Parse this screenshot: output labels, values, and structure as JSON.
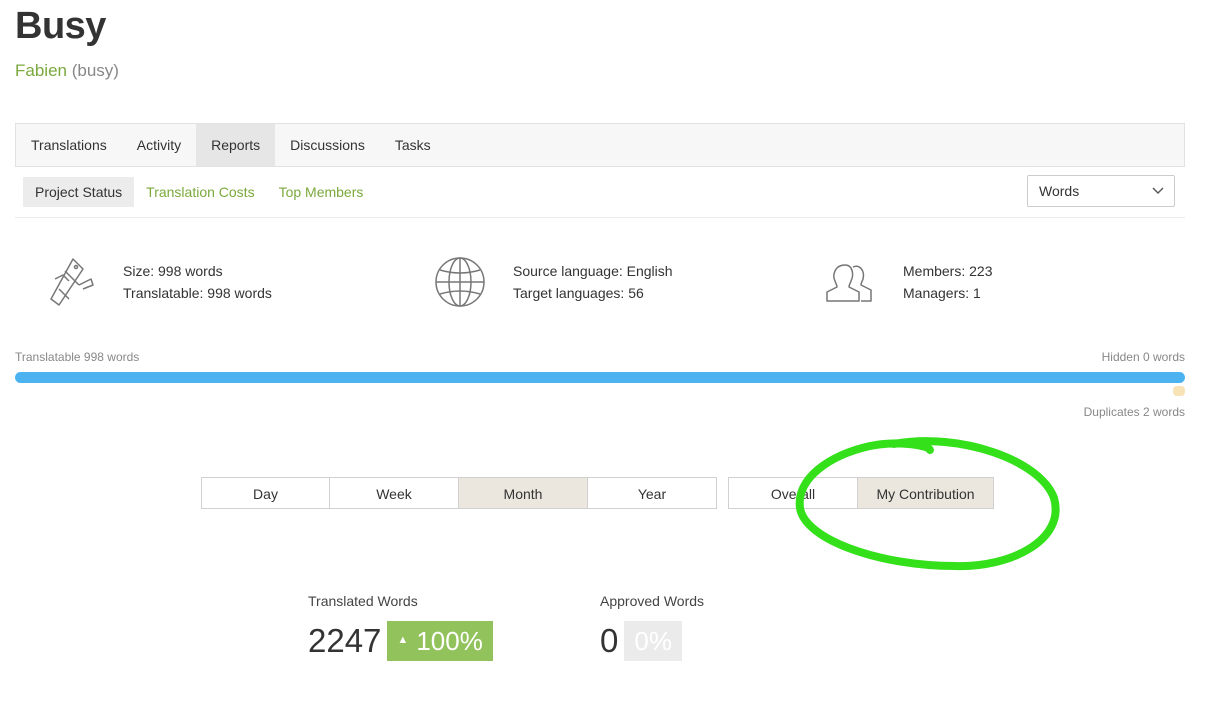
{
  "project": {
    "title": "Busy",
    "owner": "Fabien",
    "handle": "(busy)"
  },
  "tabs": [
    {
      "label": "Translations"
    },
    {
      "label": "Activity"
    },
    {
      "label": "Reports",
      "active": true
    },
    {
      "label": "Discussions"
    },
    {
      "label": "Tasks"
    }
  ],
  "subtabs": [
    {
      "label": "Project Status",
      "active": true
    },
    {
      "label": "Translation Costs"
    },
    {
      "label": "Top Members"
    }
  ],
  "unit_select": {
    "value": "Words"
  },
  "stats": {
    "size": "Size: 998 words",
    "translatable": "Translatable: 998 words",
    "source_language": "Source language: English",
    "target_languages": "Target languages: 56",
    "members": "Members: 223",
    "managers": "Managers: 1"
  },
  "progress": {
    "left_label": "Translatable 998 words",
    "right_label": "Hidden 0 words",
    "duplicates_label": "Duplicates 2 words",
    "translatable_fraction": 1.0,
    "color": "#4db3f0"
  },
  "period_buttons": [
    "Day",
    "Week",
    "Month",
    "Year"
  ],
  "period_active": "Month",
  "scope_buttons": [
    "Overall",
    "My Contribution"
  ],
  "scope_active": "My Contribution",
  "metrics": {
    "translated": {
      "label": "Translated Words",
      "value": "2247",
      "change": "100%"
    },
    "approved": {
      "label": "Approved Words",
      "value": "0",
      "change": "0%"
    }
  },
  "colors": {
    "accent_green": "#7aa93c",
    "annotation_green": "#33e01a"
  }
}
